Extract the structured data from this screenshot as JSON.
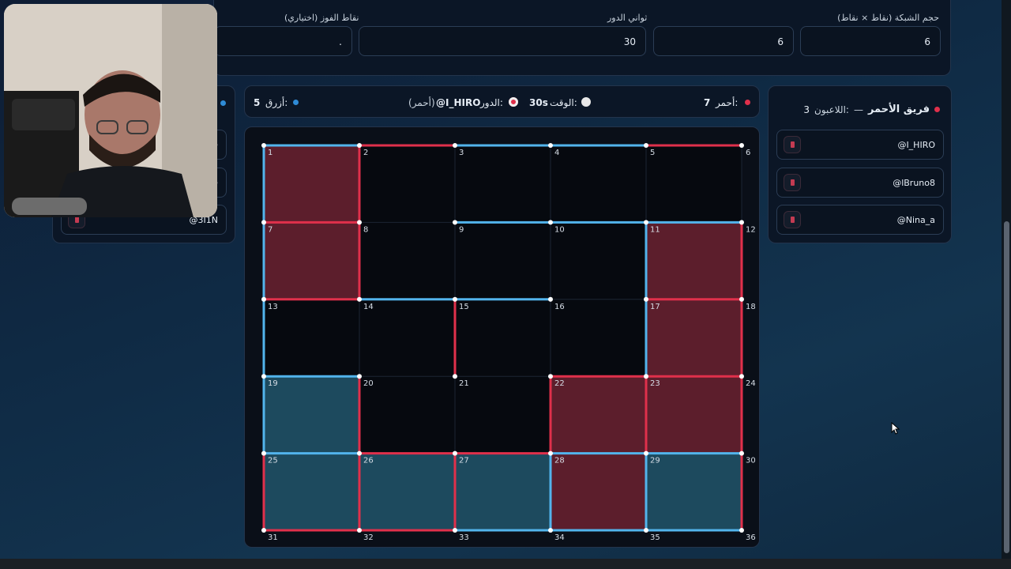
{
  "settings": {
    "grid_size_label": "حجم الشبكة (نقاط × نقاط)",
    "grid_rows_value": "6",
    "grid_cols_value": "6",
    "turn_seconds_label": "ثواني الدور",
    "turn_seconds_value": "30",
    "win_points_label": "نقاط الفوز (اختياري)",
    "win_points_value": "."
  },
  "red_team": {
    "title": "فريق الأحمر",
    "separator": "—",
    "players_label": "اللاعبون:",
    "players_count": "3",
    "players": [
      "@I_HIRO",
      "@lBruno8",
      "@Nina_a"
    ],
    "color": "#e0304b"
  },
  "blue_team": {
    "players": [
      "@",
      "@",
      "@3I1N"
    ],
    "color": "#2f8bd6"
  },
  "status": {
    "red_label": "أحمر:",
    "red_score": "7",
    "timer_label": "الوقت:",
    "timer_value": "30s",
    "turn_label": "الدور:",
    "turn_player": "@I_HIRO",
    "turn_team": "(أحمر)",
    "blue_label": "أزرق:",
    "blue_score": "5",
    "timer_icon": "stopwatch-icon",
    "turn_icon": "target-icon"
  },
  "board": {
    "rows": 6,
    "cols": 6,
    "cells": [
      [
        "red",
        "empty",
        "empty",
        "empty",
        "empty"
      ],
      [
        "red",
        "empty",
        "empty",
        "empty",
        "red"
      ],
      [
        "empty",
        "empty",
        "empty",
        "empty",
        "red"
      ],
      [
        "blue",
        "empty",
        "empty",
        "red",
        "red"
      ],
      [
        "blue",
        "blue",
        "blue",
        "red",
        "blue"
      ]
    ],
    "h_lines": [
      [
        "blue",
        "red",
        "blue",
        "blue",
        "red"
      ],
      [
        "red",
        "none",
        "blue",
        "blue",
        "blue"
      ],
      [
        "red",
        "blue",
        "blue",
        "none",
        "red"
      ],
      [
        "blue",
        "none",
        "none",
        "red",
        "red"
      ],
      [
        "blue",
        "red",
        "red",
        "blue",
        "blue"
      ],
      [
        "red",
        "red",
        "blue",
        "blue",
        "blue"
      ]
    ],
    "v_lines": [
      [
        "blue",
        "red",
        "none",
        "none",
        "none",
        "none"
      ],
      [
        "blue",
        "red",
        "none",
        "none",
        "blue",
        "red"
      ],
      [
        "blue",
        "none",
        "red",
        "none",
        "blue",
        "red"
      ],
      [
        "blue",
        "red",
        "none",
        "red",
        "red",
        "red"
      ],
      [
        "red",
        "red",
        "red",
        "blue",
        "blue",
        "red"
      ]
    ],
    "colors": {
      "red_line": "#e0304b",
      "blue_line": "#52b4ec",
      "red_fill": "#5c1e2c",
      "blue_fill": "#1d4a5e",
      "grid": "#1c2533"
    }
  }
}
